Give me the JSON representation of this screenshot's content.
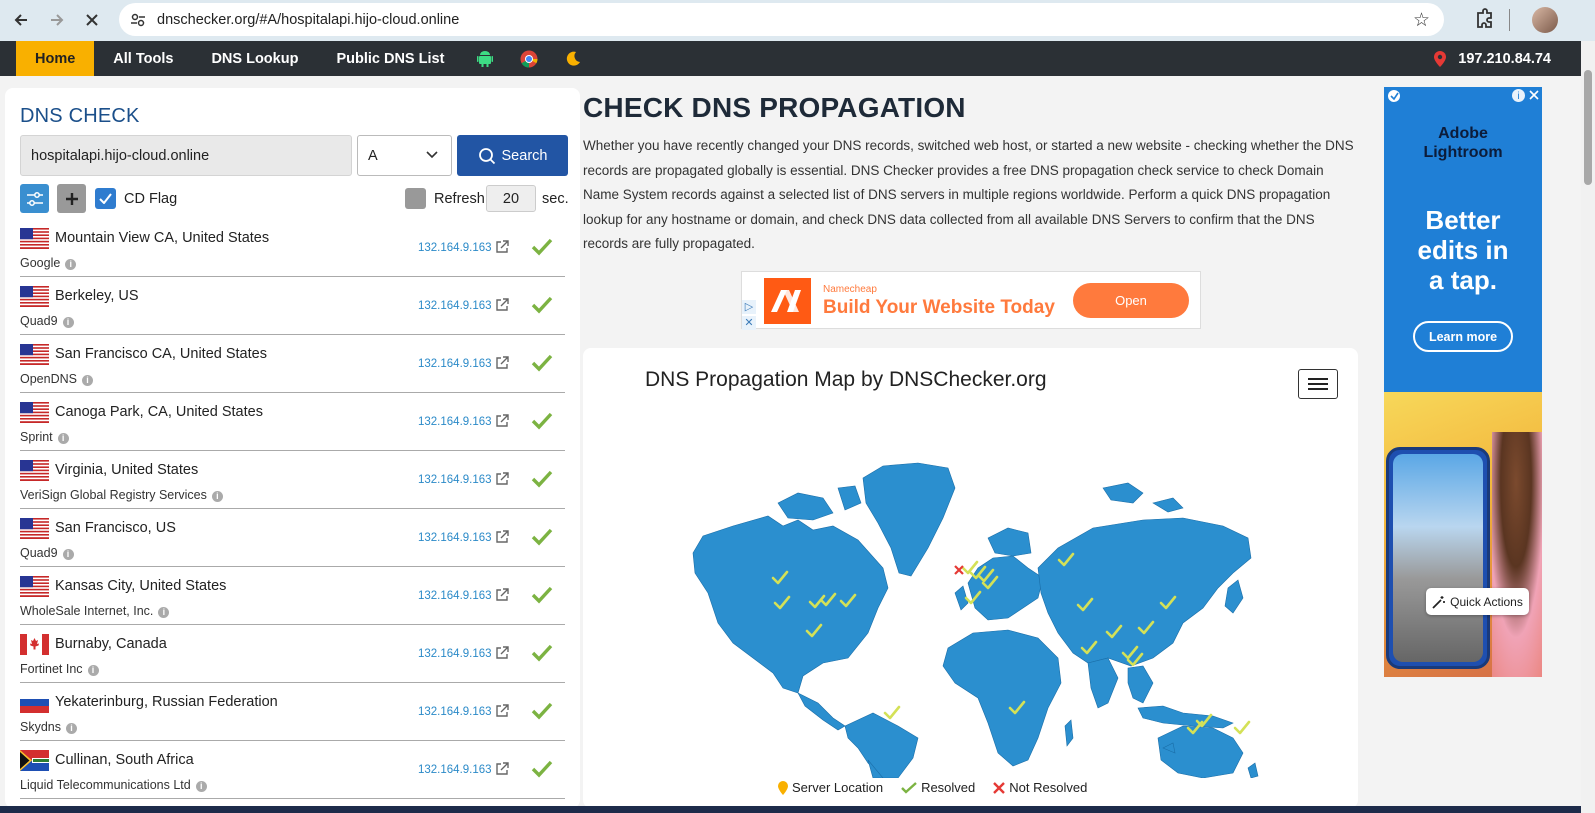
{
  "browser": {
    "url": "dnschecker.org/#A/hospitalapi.hijo-cloud.online"
  },
  "nav": {
    "tabs": [
      "Home",
      "All Tools",
      "DNS Lookup",
      "Public DNS List"
    ],
    "ip": "197.210.84.74"
  },
  "check": {
    "title": "DNS CHECK",
    "domain": "hospitalapi.hijo-cloud.online",
    "record_type": "A",
    "search_label": "Search",
    "cd_flag_label": "CD Flag",
    "refresh_label": "Refresh:",
    "refresh_value": "20",
    "sec_label": "sec."
  },
  "servers": [
    {
      "location": "Mountain View CA, United States",
      "provider": "Google",
      "ip": "132.164.9.163",
      "flag": "us"
    },
    {
      "location": "Berkeley, US",
      "provider": "Quad9",
      "ip": "132.164.9.163",
      "flag": "us"
    },
    {
      "location": "San Francisco CA, United States",
      "provider": "OpenDNS",
      "ip": "132.164.9.163",
      "flag": "us"
    },
    {
      "location": "Canoga Park, CA, United States",
      "provider": "Sprint",
      "ip": "132.164.9.163",
      "flag": "us"
    },
    {
      "location": "Virginia, United States",
      "provider": "VeriSign Global Registry Services",
      "ip": "132.164.9.163",
      "flag": "us"
    },
    {
      "location": "San Francisco, US",
      "provider": "Quad9",
      "ip": "132.164.9.163",
      "flag": "us"
    },
    {
      "location": "Kansas City, United States",
      "provider": "WholeSale Internet, Inc.",
      "ip": "132.164.9.163",
      "flag": "us"
    },
    {
      "location": "Burnaby, Canada",
      "provider": "Fortinet Inc",
      "ip": "132.164.9.163",
      "flag": "ca"
    },
    {
      "location": "Yekaterinburg, Russian Federation",
      "provider": "Skydns",
      "ip": "132.164.9.163",
      "flag": "ru"
    },
    {
      "location": "Cullinan, South Africa",
      "provider": "Liquid Telecommunications Ltd",
      "ip": "132.164.9.163",
      "flag": "za"
    }
  ],
  "main": {
    "title": "CHECK DNS PROPAGATION",
    "description": "Whether you have recently changed your DNS records, switched web host, or started a new website - checking whether the DNS records are propagated globally is essential. DNS Checker provides a free DNS propagation check service to check Domain Name System records against a selected list of DNS servers in multiple regions worldwide. Perform a quick DNS propagation lookup for any hostname or domain, and check DNS data collected from all available DNS Servers to confirm that the DNS records are fully propagated."
  },
  "ad_banner": {
    "brand": "Namecheap",
    "headline": "Build Your Website Today",
    "button": "Open"
  },
  "map": {
    "title": "DNS Propagation Map by DNSChecker.org",
    "legend": [
      "Server Location",
      "Resolved",
      "Not Resolved"
    ]
  },
  "side_ad": {
    "brand_line1": "Adobe",
    "brand_line2": "Lightroom",
    "headline_1": "Better",
    "headline_2": "edits in",
    "headline_3": "a tap.",
    "cta": "Learn more"
  },
  "quick_actions": "Quick Actions",
  "colors": {
    "accent": "#f9b000",
    "nav_bg": "#2b3035",
    "search_btn": "#2255a4",
    "resolved": "#7cb342",
    "map_land": "#2b8fcf"
  }
}
